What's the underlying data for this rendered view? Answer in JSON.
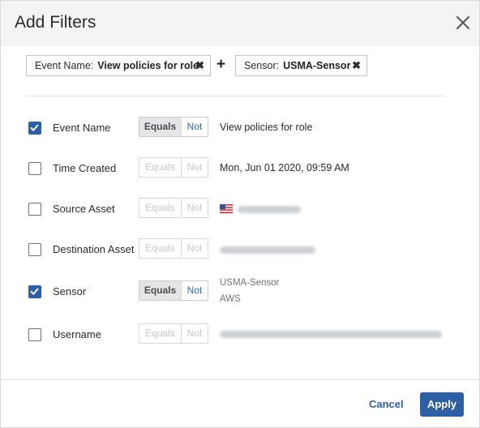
{
  "dialog": {
    "title": "Add Filters",
    "close_icon": "close-icon"
  },
  "chips": [
    {
      "key": "Event Name:",
      "value": "View policies for role",
      "remove": "✖"
    },
    {
      "key": "Sensor:",
      "value": "USMA-Sensor",
      "remove": "✖"
    }
  ],
  "chip_join": "+",
  "segment": {
    "equals": "Equals",
    "not": "Not"
  },
  "rows": [
    {
      "label": "Event Name",
      "checked": true,
      "value": "View policies for role"
    },
    {
      "label": "Time Created",
      "checked": false,
      "value": "Mon, Jun 01 2020, 09:59 AM"
    },
    {
      "label": "Source Asset",
      "checked": false,
      "value_icon": "us-flag-icon"
    },
    {
      "label": "Destination Asset",
      "checked": false
    },
    {
      "label": "Sensor",
      "checked": true,
      "value": "USMA-Sensor",
      "value2": "AWS"
    },
    {
      "label": "Username",
      "checked": false
    }
  ],
  "footer": {
    "cancel": "Cancel",
    "apply": "Apply"
  },
  "colors": {
    "primary": "#2d5fa5",
    "header_bg": "#f4f4f5"
  }
}
